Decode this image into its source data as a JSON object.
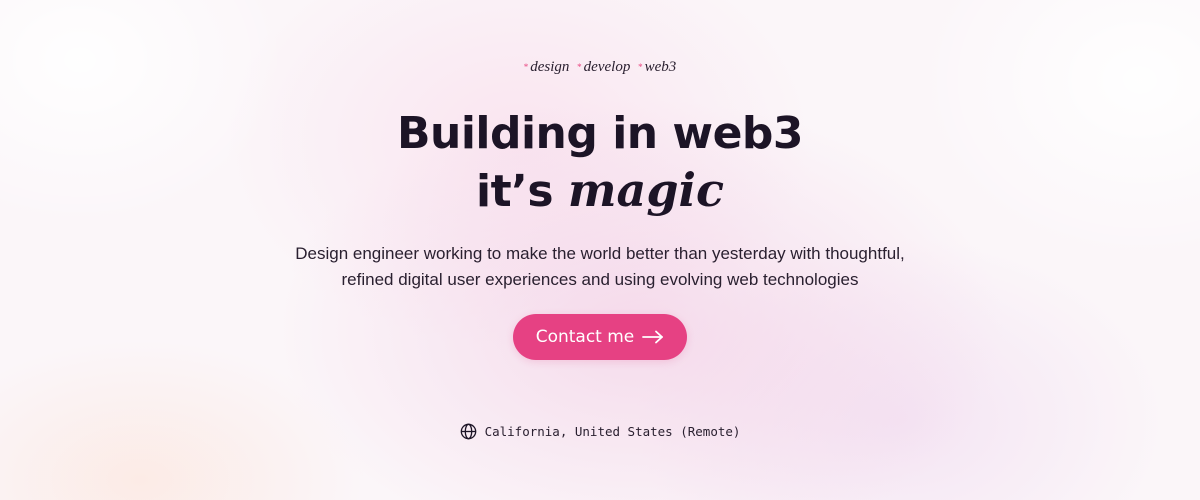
{
  "hero": {
    "tags": [
      {
        "star": "*",
        "label": "design"
      },
      {
        "star": "*",
        "label": "develop"
      },
      {
        "star": "*",
        "label": "web3"
      }
    ],
    "headline_line1": "Building in web3",
    "headline_line2_prefix": "it’s",
    "headline_line2_emphasis": "magic",
    "subtitle_line1": "Design engineer working to make the world better than yesterday with thoughtful,",
    "subtitle_line2": "refined digital user experiences and using evolving web technologies",
    "cta_label": "Contact me",
    "cta_icon": "arrow-right-icon",
    "location_icon": "globe-icon",
    "location_text": "California, United States (Remote)"
  },
  "colors": {
    "accent": "#e64183",
    "text": "#1c1426",
    "background": "#fbf6f9"
  }
}
